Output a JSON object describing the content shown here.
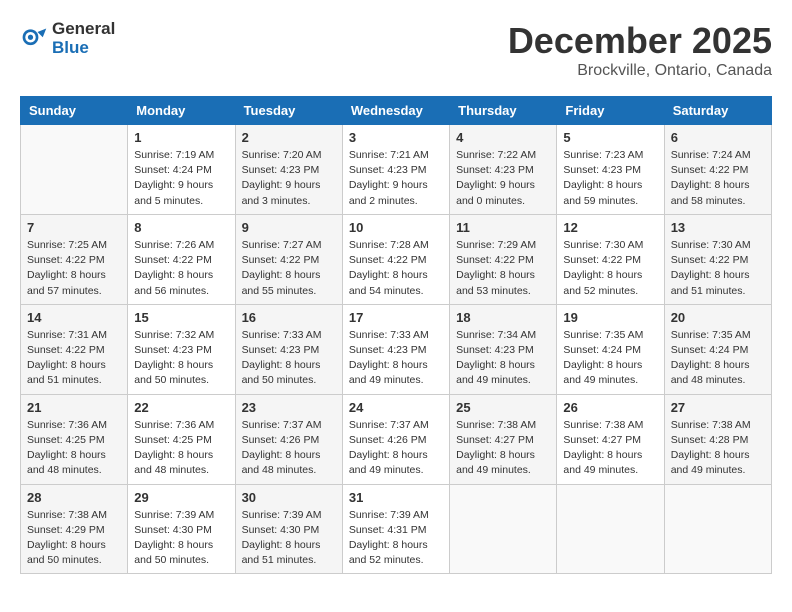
{
  "logo": {
    "text_general": "General",
    "text_blue": "Blue"
  },
  "title": "December 2025",
  "subtitle": "Brockville, Ontario, Canada",
  "days_of_week": [
    "Sunday",
    "Monday",
    "Tuesday",
    "Wednesday",
    "Thursday",
    "Friday",
    "Saturday"
  ],
  "weeks": [
    [
      {
        "num": "",
        "empty": true
      },
      {
        "num": "1",
        "sunrise": "7:19 AM",
        "sunset": "4:24 PM",
        "daylight": "9 hours and 5 minutes."
      },
      {
        "num": "2",
        "sunrise": "7:20 AM",
        "sunset": "4:23 PM",
        "daylight": "9 hours and 3 minutes."
      },
      {
        "num": "3",
        "sunrise": "7:21 AM",
        "sunset": "4:23 PM",
        "daylight": "9 hours and 2 minutes."
      },
      {
        "num": "4",
        "sunrise": "7:22 AM",
        "sunset": "4:23 PM",
        "daylight": "9 hours and 0 minutes."
      },
      {
        "num": "5",
        "sunrise": "7:23 AM",
        "sunset": "4:23 PM",
        "daylight": "8 hours and 59 minutes."
      },
      {
        "num": "6",
        "sunrise": "7:24 AM",
        "sunset": "4:22 PM",
        "daylight": "8 hours and 58 minutes."
      }
    ],
    [
      {
        "num": "7",
        "sunrise": "7:25 AM",
        "sunset": "4:22 PM",
        "daylight": "8 hours and 57 minutes."
      },
      {
        "num": "8",
        "sunrise": "7:26 AM",
        "sunset": "4:22 PM",
        "daylight": "8 hours and 56 minutes."
      },
      {
        "num": "9",
        "sunrise": "7:27 AM",
        "sunset": "4:22 PM",
        "daylight": "8 hours and 55 minutes."
      },
      {
        "num": "10",
        "sunrise": "7:28 AM",
        "sunset": "4:22 PM",
        "daylight": "8 hours and 54 minutes."
      },
      {
        "num": "11",
        "sunrise": "7:29 AM",
        "sunset": "4:22 PM",
        "daylight": "8 hours and 53 minutes."
      },
      {
        "num": "12",
        "sunrise": "7:30 AM",
        "sunset": "4:22 PM",
        "daylight": "8 hours and 52 minutes."
      },
      {
        "num": "13",
        "sunrise": "7:30 AM",
        "sunset": "4:22 PM",
        "daylight": "8 hours and 51 minutes."
      }
    ],
    [
      {
        "num": "14",
        "sunrise": "7:31 AM",
        "sunset": "4:22 PM",
        "daylight": "8 hours and 51 minutes."
      },
      {
        "num": "15",
        "sunrise": "7:32 AM",
        "sunset": "4:23 PM",
        "daylight": "8 hours and 50 minutes."
      },
      {
        "num": "16",
        "sunrise": "7:33 AM",
        "sunset": "4:23 PM",
        "daylight": "8 hours and 50 minutes."
      },
      {
        "num": "17",
        "sunrise": "7:33 AM",
        "sunset": "4:23 PM",
        "daylight": "8 hours and 49 minutes."
      },
      {
        "num": "18",
        "sunrise": "7:34 AM",
        "sunset": "4:23 PM",
        "daylight": "8 hours and 49 minutes."
      },
      {
        "num": "19",
        "sunrise": "7:35 AM",
        "sunset": "4:24 PM",
        "daylight": "8 hours and 49 minutes."
      },
      {
        "num": "20",
        "sunrise": "7:35 AM",
        "sunset": "4:24 PM",
        "daylight": "8 hours and 48 minutes."
      }
    ],
    [
      {
        "num": "21",
        "sunrise": "7:36 AM",
        "sunset": "4:25 PM",
        "daylight": "8 hours and 48 minutes."
      },
      {
        "num": "22",
        "sunrise": "7:36 AM",
        "sunset": "4:25 PM",
        "daylight": "8 hours and 48 minutes."
      },
      {
        "num": "23",
        "sunrise": "7:37 AM",
        "sunset": "4:26 PM",
        "daylight": "8 hours and 48 minutes."
      },
      {
        "num": "24",
        "sunrise": "7:37 AM",
        "sunset": "4:26 PM",
        "daylight": "8 hours and 49 minutes."
      },
      {
        "num": "25",
        "sunrise": "7:38 AM",
        "sunset": "4:27 PM",
        "daylight": "8 hours and 49 minutes."
      },
      {
        "num": "26",
        "sunrise": "7:38 AM",
        "sunset": "4:27 PM",
        "daylight": "8 hours and 49 minutes."
      },
      {
        "num": "27",
        "sunrise": "7:38 AM",
        "sunset": "4:28 PM",
        "daylight": "8 hours and 49 minutes."
      }
    ],
    [
      {
        "num": "28",
        "sunrise": "7:38 AM",
        "sunset": "4:29 PM",
        "daylight": "8 hours and 50 minutes."
      },
      {
        "num": "29",
        "sunrise": "7:39 AM",
        "sunset": "4:30 PM",
        "daylight": "8 hours and 50 minutes."
      },
      {
        "num": "30",
        "sunrise": "7:39 AM",
        "sunset": "4:30 PM",
        "daylight": "8 hours and 51 minutes."
      },
      {
        "num": "31",
        "sunrise": "7:39 AM",
        "sunset": "4:31 PM",
        "daylight": "8 hours and 52 minutes."
      },
      {
        "num": "",
        "empty": true
      },
      {
        "num": "",
        "empty": true
      },
      {
        "num": "",
        "empty": true
      }
    ]
  ]
}
